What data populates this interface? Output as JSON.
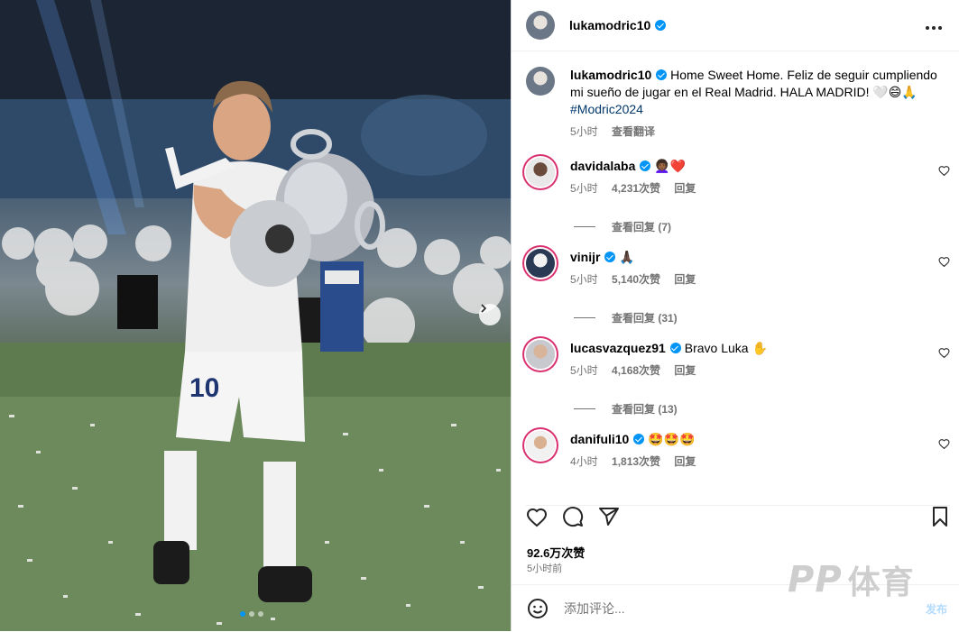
{
  "post": {
    "author": "lukamodric10",
    "more_icon": "more-horizontal-icon",
    "caption": {
      "username": "lukamodric10",
      "text": "Home Sweet Home. Feliz de seguir cumpliendo mi sueño de jugar en el Real Madrid. HALA MADRID! 🤍😄🙏",
      "hashtag": "#Modric2024",
      "time": "5小时",
      "translate": "查看翻译"
    },
    "likes": "92.6万次赞",
    "time_ago": "5小时前"
  },
  "comments": [
    {
      "username": "davidalaba",
      "text": "👩🏾‍🦱❤️",
      "time": "5小时",
      "likes": "4,231次赞",
      "reply": "回复",
      "view_replies": "查看回复 (7)"
    },
    {
      "username": "vinijr",
      "text": "🙏🏿",
      "time": "5小时",
      "likes": "5,140次赞",
      "reply": "回复",
      "view_replies": "查看回复 (31)"
    },
    {
      "username": "lucasvazquez91",
      "text": "Bravo Luka ✋",
      "time": "5小时",
      "likes": "4,168次赞",
      "reply": "回复",
      "view_replies": "查看回复 (13)"
    },
    {
      "username": "danifuli10",
      "text": "🤩🤩🤩",
      "time": "4小时",
      "likes": "1,813次赞",
      "reply": "回复",
      "view_replies": ""
    }
  ],
  "add_comment": {
    "placeholder": "添加评论...",
    "post_label": "发布"
  },
  "watermark": {
    "logo": "PP",
    "text": "体育"
  },
  "colors": {
    "accent": "#0095f6",
    "muted": "#737373",
    "link": "#00376b"
  }
}
